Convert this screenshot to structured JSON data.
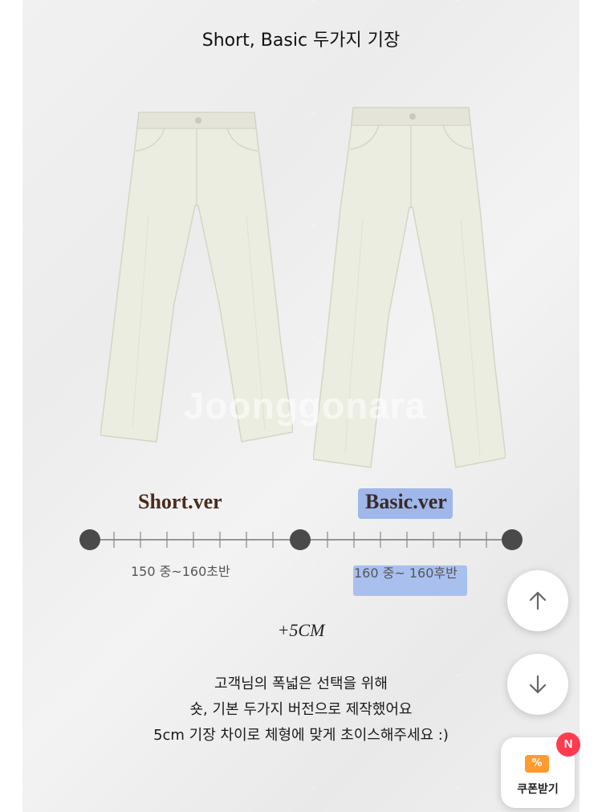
{
  "heading": "Short, Basic 두가지 기장",
  "watermark": "Joonggonara",
  "labels": {
    "short_ver": "Short.ver",
    "basic_ver": "Basic.ver"
  },
  "ranges": {
    "short": "150 중~160초반",
    "basic": "160 중~ 160후반"
  },
  "plus_length": "+5CM",
  "description": {
    "line1": "고객님의 폭넓은 선택을 위해",
    "line2": "숏, 기본 두가지 버전으로 제작했어요",
    "line3": "5cm 기장 차이로 체형에 맞게 초이스해주세요 :)"
  },
  "buttons": {
    "scroll_up_icon": "arrow-up-icon",
    "scroll_down_icon": "arrow-down-icon",
    "coupon_label": "쿠폰받기",
    "coupon_badge": "N"
  },
  "colors": {
    "highlight": "#9fb7ea",
    "badge": "#ff3b4f",
    "coupon_icon": "#ff9a2e"
  }
}
